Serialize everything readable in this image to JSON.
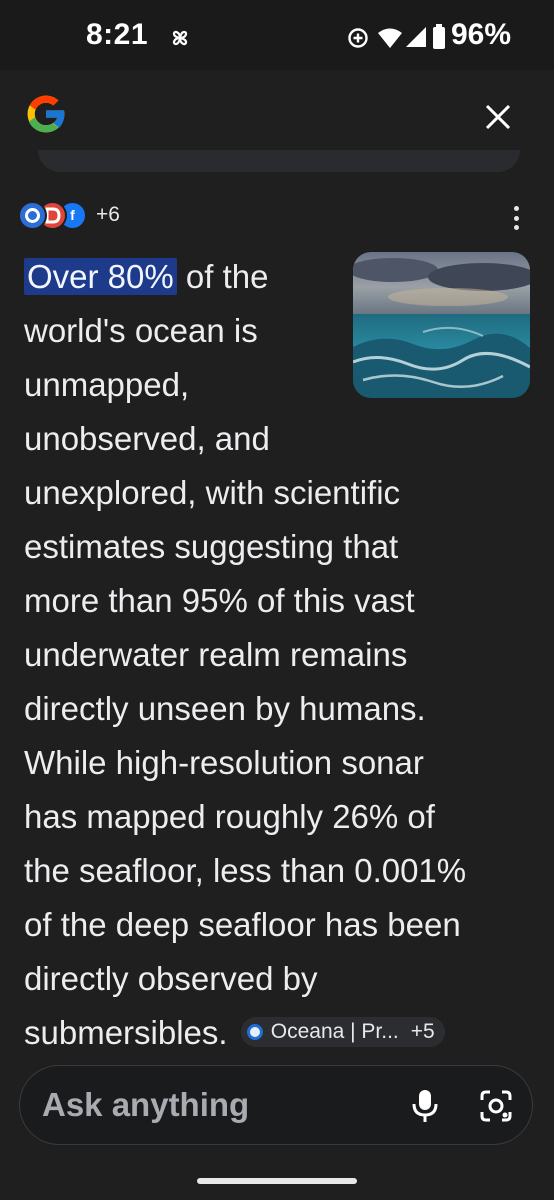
{
  "status": {
    "time": "8:21",
    "battery": "96%"
  },
  "header": {
    "logo_icon": "google-g-logo",
    "close_icon": "close-icon"
  },
  "sources": {
    "more_count": "+6",
    "favicons": [
      "source-favicon-1",
      "source-favicon-2",
      "facebook-favicon"
    ]
  },
  "answer": {
    "highlight": "Over 80%",
    "lines": [
      "of the",
      "world's ocean is",
      "unmapped,",
      "unobserved, and",
      "unexplored, with scientific",
      "estimates suggesting that",
      "more than 95% of this vast",
      "underwater realm remains",
      "directly unseen by humans.",
      "While high-resolution sonar",
      "has mapped roughly 26% of",
      "the seafloor, less than 0.001%",
      "of the deep seafloor has been",
      "directly observed by",
      "submersibles."
    ],
    "citation": {
      "label": "Oceana | Pr...",
      "count": "+5"
    }
  },
  "input": {
    "placeholder": "Ask anything"
  },
  "colors": {
    "background": "#1f1f20",
    "highlight": "#1e3a8a",
    "text": "#ededef"
  }
}
